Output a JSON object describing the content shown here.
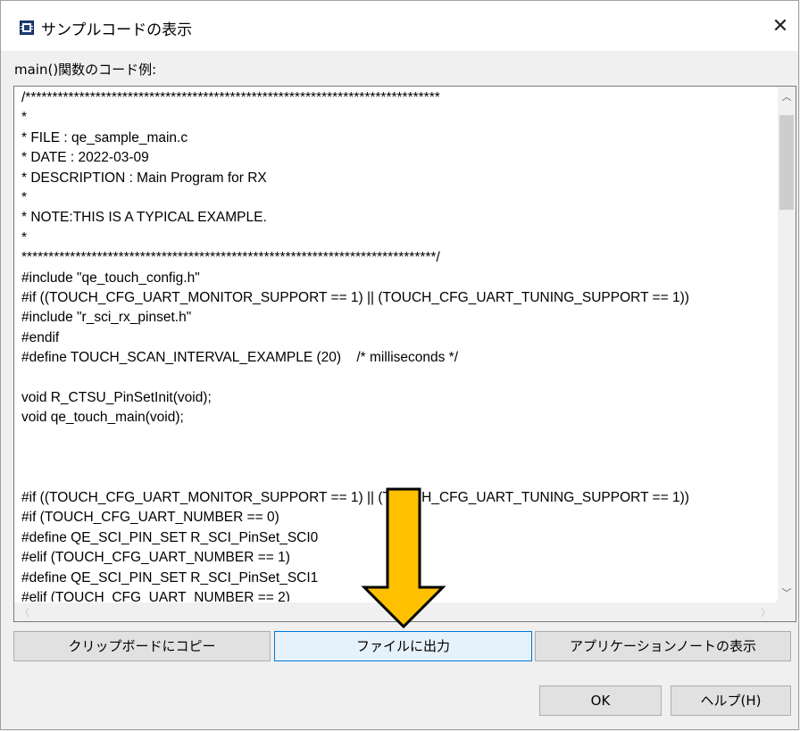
{
  "window": {
    "title": "サンプルコードの表示",
    "close_glyph": "✕"
  },
  "section_label": "main()関数のコード例:",
  "code_lines": [
    "/*****************************************************************************",
    "*",
    "* FILE : qe_sample_main.c",
    "* DATE : 2022-03-09",
    "* DESCRIPTION : Main Program for RX",
    "*",
    "* NOTE:THIS IS A TYPICAL EXAMPLE.",
    "*",
    "*****************************************************************************/",
    "#include \"qe_touch_config.h\"",
    "#if ((TOUCH_CFG_UART_MONITOR_SUPPORT == 1) || (TOUCH_CFG_UART_TUNING_SUPPORT == 1))",
    "#include \"r_sci_rx_pinset.h\"",
    "#endif",
    "#define TOUCH_SCAN_INTERVAL_EXAMPLE (20)    /* milliseconds */",
    "",
    "void R_CTSU_PinSetInit(void);",
    "void qe_touch_main(void);",
    "",
    "",
    "",
    "#if ((TOUCH_CFG_UART_MONITOR_SUPPORT == 1) || (TOUCH_CFG_UART_TUNING_SUPPORT == 1))",
    "#if (TOUCH_CFG_UART_NUMBER == 0)",
    "#define QE_SCI_PIN_SET R_SCI_PinSet_SCI0",
    "#elif (TOUCH_CFG_UART_NUMBER == 1)",
    "#define QE_SCI_PIN_SET R_SCI_PinSet_SCI1",
    "#elif (TOUCH_CFG_UART_NUMBER == 2)"
  ],
  "buttons": {
    "copy_clipboard": "クリップボードにコピー",
    "output_file": "ファイルに出力",
    "show_appnote": "アプリケーションノートの表示",
    "ok": "OK",
    "help": "ヘルプ(H)"
  },
  "icons": {
    "app": "app-icon",
    "arrow": "down-arrow-annotation"
  },
  "colors": {
    "annotation_arrow": "#ffc000",
    "focus_border": "#0078d7"
  }
}
